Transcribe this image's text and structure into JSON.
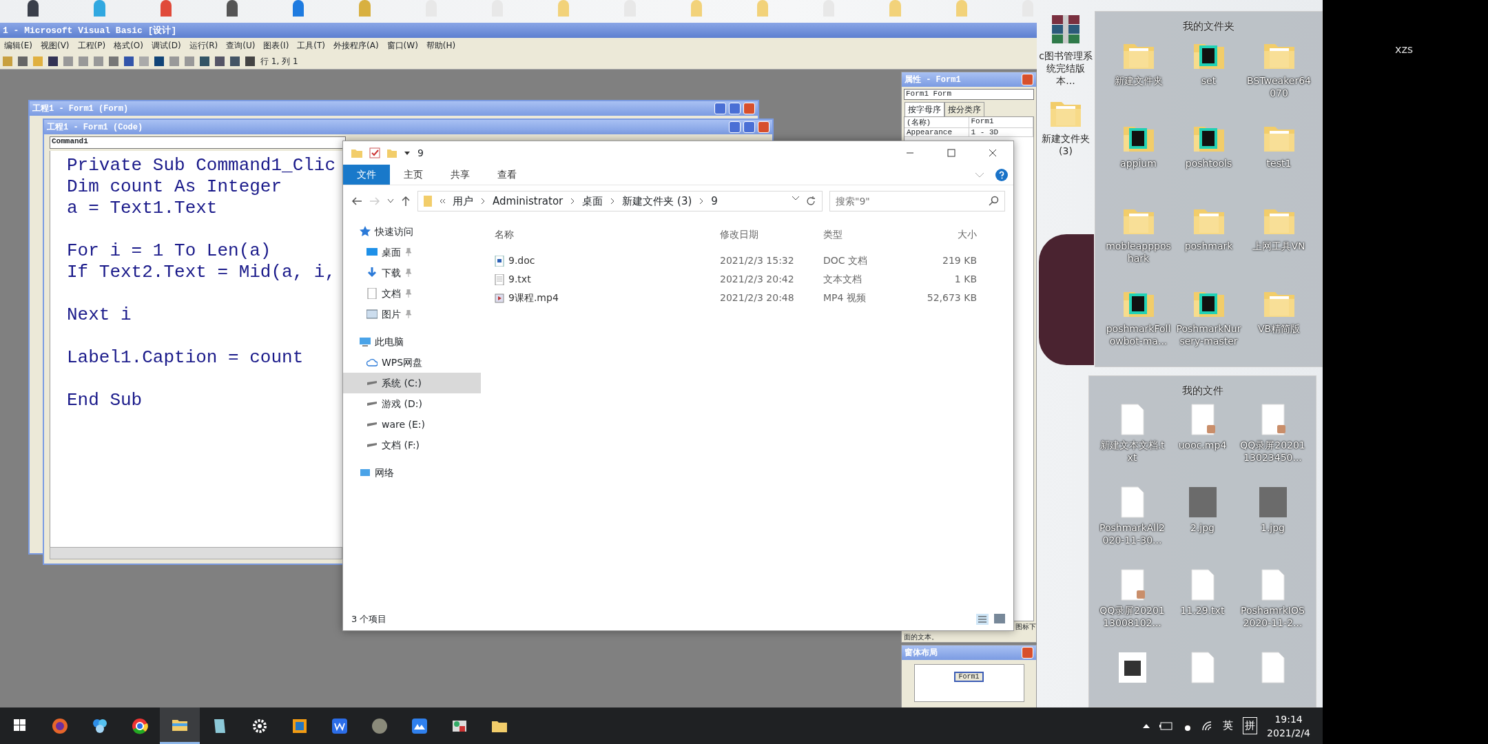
{
  "vb": {
    "title": "1 - Microsoft Visual Basic [设计]",
    "menu": [
      "编辑(E)",
      "视图(V)",
      "工程(P)",
      "格式(O)",
      "调试(D)",
      "运行(R)",
      "查询(U)",
      "图表(I)",
      "工具(T)",
      "外接程序(A)",
      "窗口(W)",
      "帮助(H)"
    ],
    "cursor_position": "行 1, 列 1",
    "form_window": {
      "title": "工程1 - Form1 (Form)"
    },
    "code_window": {
      "title": "工程1 - Form1 (Code)",
      "object": "Command1",
      "code_blocks": [
        [
          "Private Sub Command1_Clic",
          "Dim count As Integer",
          "a = Text1.Text"
        ],
        [
          "For i = 1 To Len(a)",
          "If Text2.Text = Mid(a, i,"
        ],
        [
          "Next i"
        ],
        [
          "Label1.Caption = count"
        ],
        [
          "End Sub"
        ]
      ]
    },
    "properties": {
      "title": "属性 - Form1",
      "object": "Form1 Form",
      "tabs": [
        {
          "label": "按字母序",
          "selected": true
        },
        {
          "label": "按分类序",
          "selected": false
        }
      ],
      "rows": [
        {
          "name": "(名称)",
          "value": "Form1"
        },
        {
          "name": "Appearance",
          "value": "1 - 3D"
        }
      ],
      "description": [
        "图标下",
        "面的文本。"
      ]
    },
    "form_layout": {
      "title": "窗体布局",
      "form_label": "Form1"
    }
  },
  "explorer": {
    "title": "9",
    "ribbon_tabs": [
      {
        "label": "文件",
        "selected": true
      },
      {
        "label": "主页",
        "selected": false
      },
      {
        "label": "共享",
        "selected": false
      },
      {
        "label": "查看",
        "selected": false
      }
    ],
    "path": [
      "用户",
      "Administrator",
      "桌面",
      "新建文件夹 (3)",
      "9"
    ],
    "search": {
      "placeholder": "搜索\"9\""
    },
    "nav": [
      {
        "label": "快速访问",
        "kind": "star",
        "selected": false,
        "children": [
          {
            "label": "桌面",
            "kind": "desktop",
            "selected": false
          },
          {
            "label": "下载",
            "kind": "download",
            "selected": false
          },
          {
            "label": "文档",
            "kind": "document",
            "selected": false
          },
          {
            "label": "图片",
            "kind": "picture",
            "selected": false
          }
        ]
      },
      {
        "label": "此电脑",
        "kind": "computer",
        "selected": false,
        "children": [
          {
            "label": "WPS网盘",
            "kind": "cloud",
            "selected": false
          },
          {
            "label": "系统 (C:)",
            "kind": "drive",
            "selected": true
          },
          {
            "label": "游戏 (D:)",
            "kind": "drive",
            "selected": false
          },
          {
            "label": "ware (E:)",
            "kind": "drive",
            "selected": false
          },
          {
            "label": "文档 (F:)",
            "kind": "drive",
            "selected": false
          }
        ]
      },
      {
        "label": "网络",
        "kind": "network",
        "selected": false
      }
    ],
    "columns": [
      "名称",
      "修改日期",
      "类型",
      "大小"
    ],
    "files": [
      {
        "name": "9.doc",
        "kind": "word",
        "modified": "2021/2/3 15:32",
        "type": "DOC 文档",
        "size": "219 KB"
      },
      {
        "name": "9.txt",
        "kind": "text",
        "modified": "2021/2/3 20:42",
        "type": "文本文档",
        "size": "1 KB"
      },
      {
        "name": "9课程.mp4",
        "kind": "video",
        "modified": "2021/2/3 20:48",
        "type": "MP4 视频",
        "size": "52,673 KB"
      }
    ],
    "status": "3 个项目"
  },
  "desktop": {
    "icons": [
      {
        "label": "c图书管理系统完结版本...",
        "kind": "archive"
      },
      {
        "label": "新建文件夹 (3)",
        "kind": "folder"
      }
    ],
    "folder_panel": {
      "title": "我的文件夹",
      "items": [
        {
          "label": "新建文件夹",
          "kind": "folder"
        },
        {
          "label": "set",
          "kind": "project"
        },
        {
          "label": "BSTweaker64070",
          "kind": "folder"
        },
        {
          "label": "appium",
          "kind": "project"
        },
        {
          "label": "poshtools",
          "kind": "project"
        },
        {
          "label": "test1",
          "kind": "folder"
        },
        {
          "label": "mobleappposhark",
          "kind": "folder"
        },
        {
          "label": "poshmark",
          "kind": "folder"
        },
        {
          "label": "上网工具VN",
          "kind": "folder"
        },
        {
          "label": "poshmarkFollowbot-ma...",
          "kind": "project"
        },
        {
          "label": "PoshmarkNursery-master",
          "kind": "project"
        },
        {
          "label": "VB精简版",
          "kind": "folder"
        }
      ]
    },
    "file_panel": {
      "title": "我的文件",
      "items": [
        {
          "label": "新建文本文档.txt",
          "kind": "text"
        },
        {
          "label": "uooc.mp4",
          "kind": "video"
        },
        {
          "label": "QQ录屏2020113023450...",
          "kind": "video"
        },
        {
          "label": "PoshmarkAll2020-11-30...",
          "kind": "text"
        },
        {
          "label": "2.jpg",
          "kind": "photo"
        },
        {
          "label": "1.jpg",
          "kind": "photo"
        },
        {
          "label": "QQ录屏2020113008102...",
          "kind": "video"
        },
        {
          "label": "11.29.txt",
          "kind": "text"
        },
        {
          "label": "PoshamrkIOS2020-11-2...",
          "kind": "text"
        },
        {
          "kind": "qr"
        },
        {
          "kind": "text"
        },
        {
          "kind": "text"
        }
      ]
    }
  },
  "screen_label": "xzs",
  "taskbar": {
    "apps": [
      {
        "kind": "firefox",
        "selected": false
      },
      {
        "kind": "photos",
        "selected": false
      },
      {
        "kind": "chrome",
        "selected": false
      },
      {
        "kind": "explorer",
        "selected": true
      },
      {
        "kind": "notepad",
        "selected": false
      },
      {
        "kind": "settings",
        "selected": false
      },
      {
        "kind": "vm",
        "selected": false
      },
      {
        "kind": "wps",
        "selected": false
      },
      {
        "kind": "avatar",
        "selected": false
      },
      {
        "kind": "cloud",
        "selected": false
      },
      {
        "kind": "vb",
        "selected": false
      },
      {
        "kind": "folder",
        "selected": false
      }
    ],
    "language": "英",
    "ime": "拼",
    "time": "19:14",
    "date": "2021/2/4"
  }
}
